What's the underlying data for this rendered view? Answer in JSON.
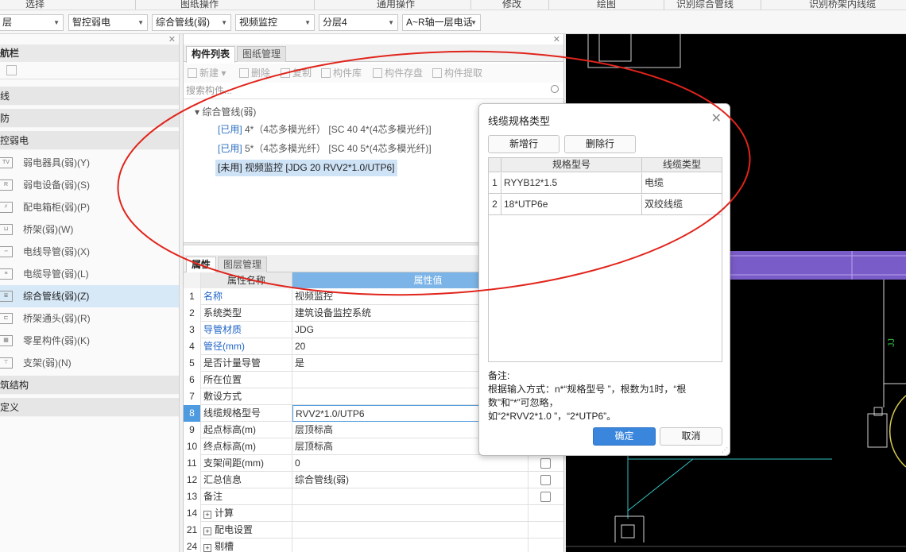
{
  "ribbon": {
    "groups": [
      "选择",
      "图纸操作",
      "通用操作",
      "修改",
      "绘图",
      "识别综合管线",
      "识别桥架内线缆"
    ]
  },
  "toolbar": {
    "combos": [
      "层",
      "智控弱电",
      "综合管线(弱)",
      "视频监控",
      "分层4",
      "A~R轴一层电话"
    ]
  },
  "leftnav": {
    "title": "航栏",
    "sections": [
      "线",
      "防",
      "控弱电",
      "筑结构",
      "定义"
    ],
    "items": [
      {
        "label": "弱电器具(弱)(Y)",
        "icon": "TV"
      },
      {
        "label": "弱电设备(弱)(S)",
        "icon": "R"
      },
      {
        "label": "配电箱柜(弱)(P)",
        "icon": "⚡"
      },
      {
        "label": "桥架(弱)(W)",
        "icon": "⊔"
      },
      {
        "label": "电线导管(弱)(X)",
        "icon": "∽"
      },
      {
        "label": "电缆导管(弱)(L)",
        "icon": "≡"
      },
      {
        "label": "综合管线(弱)(Z)",
        "icon": "≣"
      },
      {
        "label": "桥架通头(弱)(R)",
        "icon": "⊏"
      },
      {
        "label": "零星构件(弱)(K)",
        "icon": "▦"
      },
      {
        "label": "支架(弱)(N)",
        "icon": "⊤"
      }
    ]
  },
  "componentPanel": {
    "tabs": [
      "构件列表",
      "图纸管理"
    ],
    "toolbar": [
      "新建",
      "删除",
      "复制",
      "构件库",
      "构件存盘",
      "构件提取"
    ],
    "search_placeholder": "搜索构件...",
    "group": "综合管线(弱)",
    "rows": [
      {
        "tag": "[已用]",
        "text": " 4*（4芯多模光纤） [SC 40 4*(4芯多模光纤)]"
      },
      {
        "tag": "[已用]",
        "text": " 5*（4芯多模光纤） [SC 40 5*(4芯多模光纤)]"
      },
      {
        "tag": "[未用]",
        "text": " 视频监控 [JDG 20 RVV2*1.0/UTP6]"
      }
    ]
  },
  "propertyPanel": {
    "tabs": [
      "属性",
      "图层管理"
    ],
    "headers": {
      "name": "属性名称",
      "value": "属性值"
    },
    "rows": [
      {
        "n": "1",
        "k": "名称",
        "v": "视频监控",
        "blue": true,
        "check": false
      },
      {
        "n": "2",
        "k": "系统类型",
        "v": "建筑设备监控系统",
        "blue": false,
        "check": false
      },
      {
        "n": "3",
        "k": "导管材质",
        "v": "JDG",
        "blue": true,
        "check": false
      },
      {
        "n": "4",
        "k": "管径(mm)",
        "v": "20",
        "blue": true,
        "check": false
      },
      {
        "n": "5",
        "k": "是否计量导管",
        "v": "是",
        "blue": false,
        "check": false
      },
      {
        "n": "6",
        "k": "所在位置",
        "v": "",
        "blue": false,
        "check": false
      },
      {
        "n": "7",
        "k": "敷设方式",
        "v": "",
        "blue": false,
        "check": false
      },
      {
        "n": "8",
        "k": "线缆规格型号",
        "v": "RVV2*1.0/UTP6",
        "blue": false,
        "check": false
      },
      {
        "n": "9",
        "k": "起点标高(m)",
        "v": "层顶标高",
        "blue": false,
        "check": false
      },
      {
        "n": "10",
        "k": "终点标高(m)",
        "v": "层顶标高",
        "blue": false,
        "check": false
      },
      {
        "n": "11",
        "k": "支架间距(mm)",
        "v": "0",
        "blue": false,
        "check": true
      },
      {
        "n": "12",
        "k": "汇总信息",
        "v": "综合管线(弱)",
        "blue": false,
        "check": true
      },
      {
        "n": "13",
        "k": "备注",
        "v": "",
        "blue": false,
        "check": true
      },
      {
        "n": "14",
        "k": "计算",
        "v": "",
        "blue": false,
        "check": false,
        "expand": true
      },
      {
        "n": "21",
        "k": "配电设置",
        "v": "",
        "blue": false,
        "check": false,
        "expand": true
      },
      {
        "n": "24",
        "k": "剔槽",
        "v": "",
        "blue": false,
        "check": false,
        "expand": true
      }
    ]
  },
  "dialog": {
    "title": "线缆规格类型",
    "add_row": "新增行",
    "delete_row": "删除行",
    "col_model": "规格型号",
    "col_type": "线缆类型",
    "rows": [
      {
        "n": "1",
        "model": "RYYB12*1.5",
        "type": "电缆"
      },
      {
        "n": "2",
        "model": "18*UTP6e",
        "type": "双绞线缆"
      }
    ],
    "note_title": "备注:",
    "note_line1": "根据输入方式：n*“规格型号 ”，根数为1时，“根",
    "note_line2": "数”和“*”可忽略，",
    "note_line3": "如“2*RVV2*1.0 ”，“2*UTP6”。",
    "ok": "确定",
    "cancel": "取消"
  },
  "colors": {
    "accent": "#3a86dd",
    "annotation": "#e0241b",
    "cad_bg": "#000000",
    "cad_band": "#7a5cc8"
  }
}
